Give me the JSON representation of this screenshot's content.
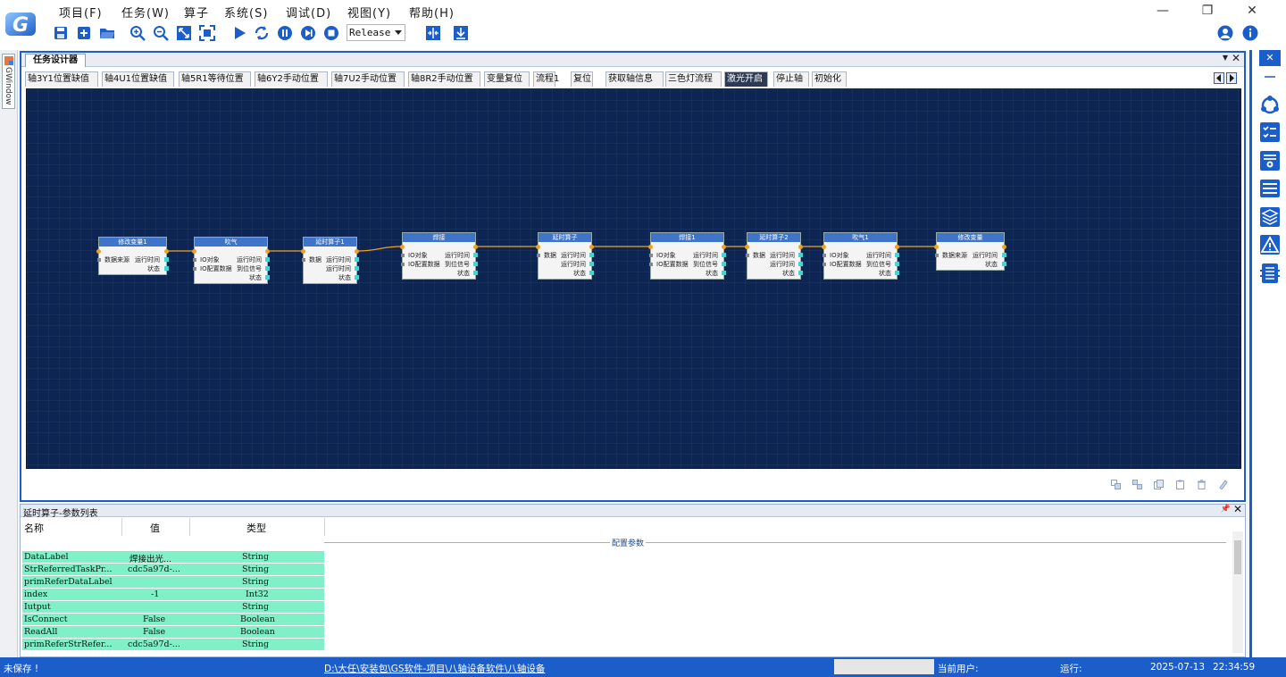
{
  "menu": [
    "项目(F)",
    "任务(W)",
    "算子",
    "系统(S)",
    "调试(D)",
    "视图(Y)",
    "帮助(H)"
  ],
  "toolbar": {
    "icons": [
      "save-icon",
      "add-icon",
      "open-folder-icon",
      "zoom-in-icon",
      "zoom-out-icon",
      "fit-icon",
      "fullscreen-icon",
      "run-icon",
      "loop-icon",
      "pause-icon",
      "step-icon",
      "stop-icon",
      "split-icon",
      "download-icon"
    ],
    "build_config": "Release"
  },
  "window_controls": {
    "minimize": "—",
    "restore": "❐",
    "close": "✕"
  },
  "left_panel": {
    "tab": "GWindow"
  },
  "document": {
    "tab_label": "任务设计器",
    "flow_tabs": [
      {
        "label": "轴3Y1位置缺值",
        "active": false
      },
      {
        "label": "轴4U1位置缺值",
        "active": false
      },
      {
        "label": "轴5R1等待位置",
        "active": false
      },
      {
        "label": "轴6Y2手动位置",
        "active": false
      },
      {
        "label": "轴7U2手动位置",
        "active": false
      },
      {
        "label": "轴8R2手动位置",
        "active": false
      },
      {
        "label": "变量复位",
        "active": false
      },
      {
        "label": "流程1",
        "active": false
      },
      {
        "label": "复位",
        "active": false
      },
      {
        "label": "获取轴信息",
        "active": false
      },
      {
        "label": "三色灯流程",
        "active": false
      },
      {
        "label": "激光开启",
        "active": true
      },
      {
        "label": "停止轴",
        "active": false
      },
      {
        "label": "初始化",
        "active": false
      }
    ],
    "nodes": [
      {
        "title": "修改变量1",
        "inputs": [
          "数据来源"
        ],
        "outputs": [
          "运行时间",
          "状态"
        ]
      },
      {
        "title": "吹气",
        "inputs": [
          "IO对象",
          "IO配置数据"
        ],
        "outputs": [
          "运行时间",
          "到位信号",
          "状态"
        ]
      },
      {
        "title": "延时算子1",
        "inputs": [
          "数据"
        ],
        "outputs": [
          "运行时间",
          "运行时间",
          "状态"
        ]
      },
      {
        "title": "焊接",
        "inputs": [
          "IO对象",
          "IO配置数据"
        ],
        "outputs": [
          "运行时间",
          "到位信号",
          "状态"
        ]
      },
      {
        "title": "延时算子",
        "inputs": [
          "数据"
        ],
        "outputs": [
          "运行时间",
          "运行时间",
          "状态"
        ]
      },
      {
        "title": "焊接1",
        "inputs": [
          "IO对象",
          "IO配置数据"
        ],
        "outputs": [
          "运行时间",
          "到位信号",
          "状态"
        ]
      },
      {
        "title": "延时算子2",
        "inputs": [
          "数据"
        ],
        "outputs": [
          "运行时间",
          "运行时间",
          "状态"
        ]
      },
      {
        "title": "吹气1",
        "inputs": [
          "IO对象",
          "IO配置数据"
        ],
        "outputs": [
          "运行时间",
          "到位信号",
          "状态"
        ]
      },
      {
        "title": "修改变量",
        "inputs": [
          "数据来源"
        ],
        "outputs": [
          "运行时间",
          "状态"
        ]
      }
    ]
  },
  "properties": {
    "title": "延时算子-参数列表",
    "headers": {
      "name": "名称",
      "value": "值",
      "type": "类型"
    },
    "section": "配置参数",
    "rows": [
      {
        "name": "DataLabel",
        "value": "焊接出光...",
        "type": "String"
      },
      {
        "name": "StrReferredTaskPr...",
        "value": "cdc5a97d-...",
        "type": "String"
      },
      {
        "name": "primReferDataLabel",
        "value": "",
        "type": "String"
      },
      {
        "name": "index",
        "value": "-1",
        "type": "Int32"
      },
      {
        "name": "Iutput",
        "value": "",
        "type": "String"
      },
      {
        "name": "IsConnect",
        "value": "False",
        "type": "Boolean"
      },
      {
        "name": "ReadAll",
        "value": "False",
        "type": "Boolean"
      },
      {
        "name": "primReferStrRefer...",
        "value": "cdc5a97d-...",
        "type": "String"
      }
    ]
  },
  "statusbar": {
    "save_state": "未保存 !",
    "path": "D:\\大任\\安装包\\GS软件-项目\\八轴设备软件\\八轴设备",
    "user_label": "当前用户:",
    "run_label": "运行:",
    "date": "2025-07-13",
    "time": "22:34:59"
  },
  "colors": {
    "accent": "#1c5ec9",
    "canvas": "#0c2552",
    "node_header": "#3f75c9",
    "param_row": "#80f0c8",
    "wire": "#f0a21b"
  }
}
